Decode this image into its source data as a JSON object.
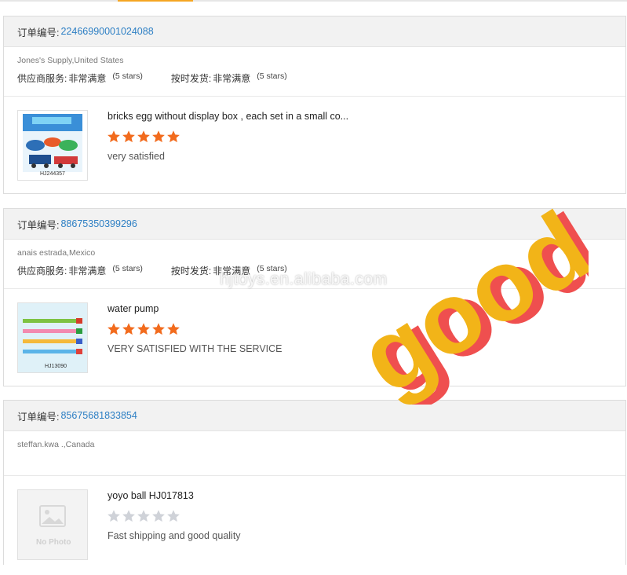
{
  "orders": [
    {
      "order_label": "订单编号:",
      "order_number": "22466990001024088",
      "buyer": "Jones's Supply,United States",
      "supplier_service_label": "供应商服务:",
      "supplier_service_value": "非常满意",
      "supplier_service_stars": "(5 stars)",
      "delivery_label": "按时发货:",
      "delivery_value": "非常满意",
      "delivery_stars": "(5 stars)",
      "item_title": "bricks egg without display box , each set in a small co...",
      "rating": 5,
      "review": "very satisfied",
      "thumb_text": "HJ244357"
    },
    {
      "order_label": "订单编号:",
      "order_number": "88675350399296",
      "buyer": "anais estrada,Mexico",
      "supplier_service_label": "供应商服务:",
      "supplier_service_value": "非常满意",
      "supplier_service_stars": "(5 stars)",
      "delivery_label": "按时发货:",
      "delivery_value": "非常满意",
      "delivery_stars": "(5 stars)",
      "item_title": "water pump",
      "rating": 5,
      "review": "VERY SATISFIED WITH THE SERVICE",
      "thumb_text": "HJ13090"
    },
    {
      "order_label": "订单编号:",
      "order_number": "85675681833854",
      "buyer": "steffan.kwa .,Canada",
      "item_title": "yoyo ball HJ017813",
      "rating": 0,
      "review": "Fast shipping and good quality",
      "thumb_text": "No Photo"
    }
  ],
  "watermark": "hjtoys.en.alibaba.com",
  "overlay_word": "good",
  "colors": {
    "star_filled": "#f26b1d",
    "star_empty": "#cfd2d8",
    "link": "#2d7fc4",
    "overlay_front": "#f2b418",
    "overlay_shadow": "#ef4f4f"
  }
}
